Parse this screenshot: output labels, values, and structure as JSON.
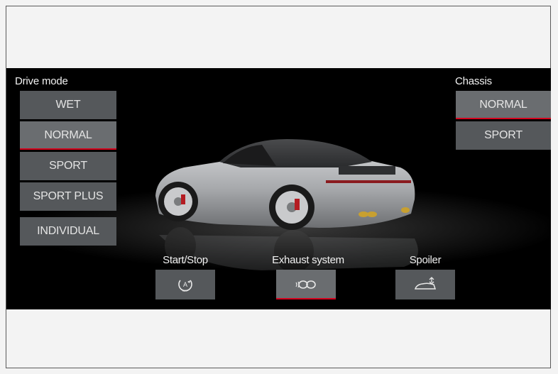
{
  "drive_mode": {
    "title": "Drive mode",
    "options": [
      {
        "label": "WET",
        "active": false
      },
      {
        "label": "NORMAL",
        "active": true
      },
      {
        "label": "SPORT",
        "active": false
      },
      {
        "label": "SPORT PLUS",
        "active": false
      },
      {
        "label": "INDIVIDUAL",
        "active": false
      }
    ]
  },
  "chassis": {
    "title": "Chassis",
    "options": [
      {
        "label": "NORMAL",
        "active": true
      },
      {
        "label": "SPORT",
        "active": false
      }
    ]
  },
  "quick_controls": [
    {
      "label": "Start/Stop",
      "icon": "auto-start-stop-icon",
      "active": false
    },
    {
      "label": "Exhaust system",
      "icon": "exhaust-icon",
      "active": true
    },
    {
      "label": "Spoiler",
      "icon": "spoiler-icon",
      "active": false
    }
  ],
  "colors": {
    "accent": "#d5001c",
    "button_bg": "#55585b",
    "button_active_bg": "#6a6d70",
    "screen_bg": "#000000"
  }
}
